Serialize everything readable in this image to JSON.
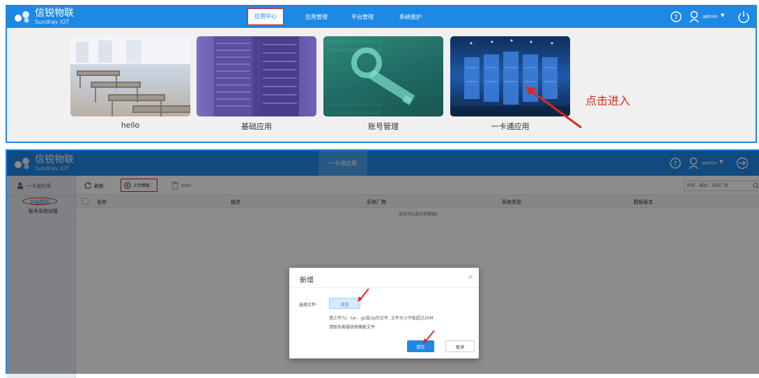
{
  "top": {
    "logo": {
      "name": "信锐物联",
      "subtitle": "Sundray IOT"
    },
    "nav": [
      "应用中心",
      "应用管理",
      "平台管理",
      "系统维护"
    ],
    "user": "admin",
    "tiles": [
      {
        "label": "hello"
      },
      {
        "label": "基础应用"
      },
      {
        "label": "账号管理"
      },
      {
        "label": "一卡通应用"
      }
    ],
    "annotation": "点击进入",
    "colors": {
      "bar": "#1e88e5",
      "annotation": "#e0261f"
    }
  },
  "bottom": {
    "logo": {
      "name": "信锐物联",
      "subtitle": "Sundray IOT"
    },
    "tab": "一卡通应用",
    "user": "admin",
    "sidebar": {
      "header": "一卡通应用",
      "items": [
        "对接模板",
        "账号系统对接"
      ]
    },
    "toolbar": {
      "refresh": "刷新",
      "upload": "上传模板",
      "delete": ""
    },
    "search": {
      "placeholder": "名称、描述、系统厂商"
    },
    "table": {
      "columns": [
        "名称",
        "描述",
        "系统厂商",
        "系统类型",
        "模板版本"
      ],
      "empty": "没有可以显示的数据!"
    },
    "dialog": {
      "title": "新增",
      "field_label": "选择文件:",
      "browse": "浏览",
      "hint1": "请上传7z、tar、gz或zip的文件, 文件大小不能超过20M",
      "hint2": "请联系客服获取模板文件",
      "submit": "提交",
      "cancel": "取消"
    }
  }
}
